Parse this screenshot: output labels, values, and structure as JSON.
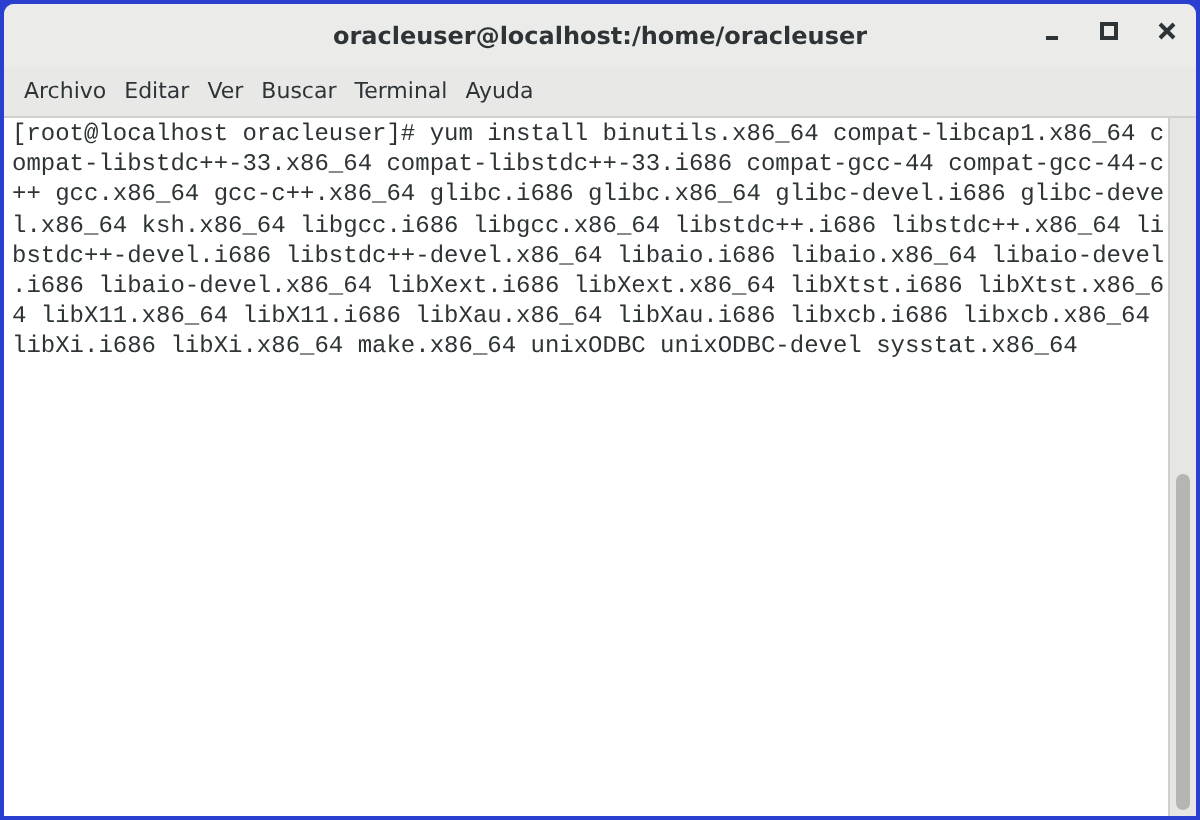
{
  "window": {
    "title": "oracleuser@localhost:/home/oracleuser"
  },
  "menu": [
    "Archivo",
    "Editar",
    "Ver",
    "Buscar",
    "Terminal",
    "Ayuda"
  ],
  "terminal": {
    "lines": [
      "[root@localhost oracleuser]# yum install binutils.x86_64 compat-libcap1.x86_64 c",
      "ompat-libstdc++-33.x86_64 compat-libstdc++-33.i686 compat-gcc-44 compat-gcc-44-c",
      "++ gcc.x86_64 gcc-c++.x86_64 glibc.i686 glibc.x86_64 glibc-devel.i686 glibc-deve",
      "l.x86_64 ksh.x86_64 libgcc.i686 libgcc.x86_64 libstdc++.i686 libstdc++.x86_64 li",
      "bstdc++-devel.i686 libstdc++-devel.x86_64 libaio.i686 libaio.x86_64 libaio-devel",
      ".i686 libaio-devel.x86_64 libXext.i686 libXext.x86_64 libXtst.i686 libXtst.x86_6",
      "4 libX11.x86_64 libX11.i686 libXau.x86_64 libXau.i686 libxcb.i686 libxcb.x86_64",
      "libXi.i686 libXi.x86_64 make.x86_64 unixODBC unixODBC-devel sysstat.x86_64"
    ]
  }
}
